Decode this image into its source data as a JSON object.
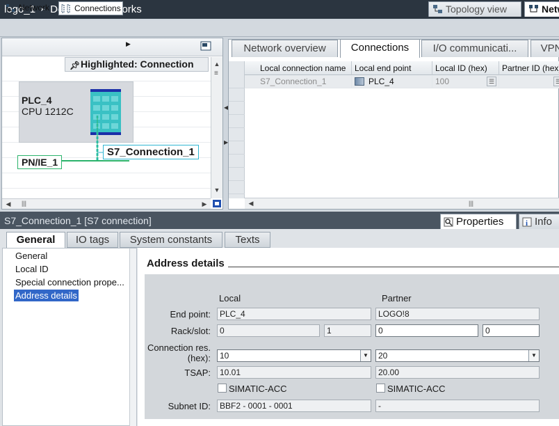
{
  "titlebar": {
    "project": "logo_1",
    "separator": "▸",
    "page": "Devices & networks"
  },
  "views": {
    "topology": "Topology view",
    "network": "Netw"
  },
  "graphic": {
    "network_button": "Network",
    "connections_button": "Connections",
    "highlighted": "Highlighted: Connection",
    "plc_name": "PLC_4",
    "plc_cpu": "CPU 1212C",
    "subnet_label": "PN/IE_1",
    "connection_label": "S7_Connection_1"
  },
  "table_tabs": [
    "Network overview",
    "Connections",
    "I/O communicati...",
    "VPN"
  ],
  "table": {
    "columns": [
      "Local connection name",
      "Local end point",
      "Local ID (hex)",
      "Partner ID (hex)"
    ],
    "rows": [
      {
        "name": "S7_Connection_1",
        "end_point": "PLC_4",
        "local_id": "100",
        "partner_id": ""
      }
    ]
  },
  "object": {
    "title": "S7_Connection_1 [S7 connection]",
    "properties_tab": "Properties",
    "info_tab": "Info"
  },
  "prop_tabs": [
    "General",
    "IO tags",
    "System constants",
    "Texts"
  ],
  "nav": [
    "General",
    "Local ID",
    "Special connection prope...",
    "Address details"
  ],
  "section": {
    "title": "Address details",
    "local_header": "Local",
    "partner_header": "Partner",
    "labels": {
      "end_point": "End point:",
      "rack_slot": "Rack/slot:",
      "conn_res_1": "Connection res.",
      "conn_res_2": "(hex):",
      "tsap": "TSAP:",
      "subnet": "Subnet ID:"
    },
    "local": {
      "end_point": "PLC_4",
      "rack": "0",
      "slot": "1",
      "conn_res": "10",
      "tsap": "10.01",
      "simatic_acc": "SIMATIC-ACC",
      "subnet_id": "BBF2 - 0001 - 0001"
    },
    "partner": {
      "end_point": "LOGO!8",
      "rack": "0",
      "slot": "0",
      "conn_res": "20",
      "tsap": "20.00",
      "simatic_acc": "SIMATIC-ACC",
      "subnet_id": "-"
    }
  }
}
